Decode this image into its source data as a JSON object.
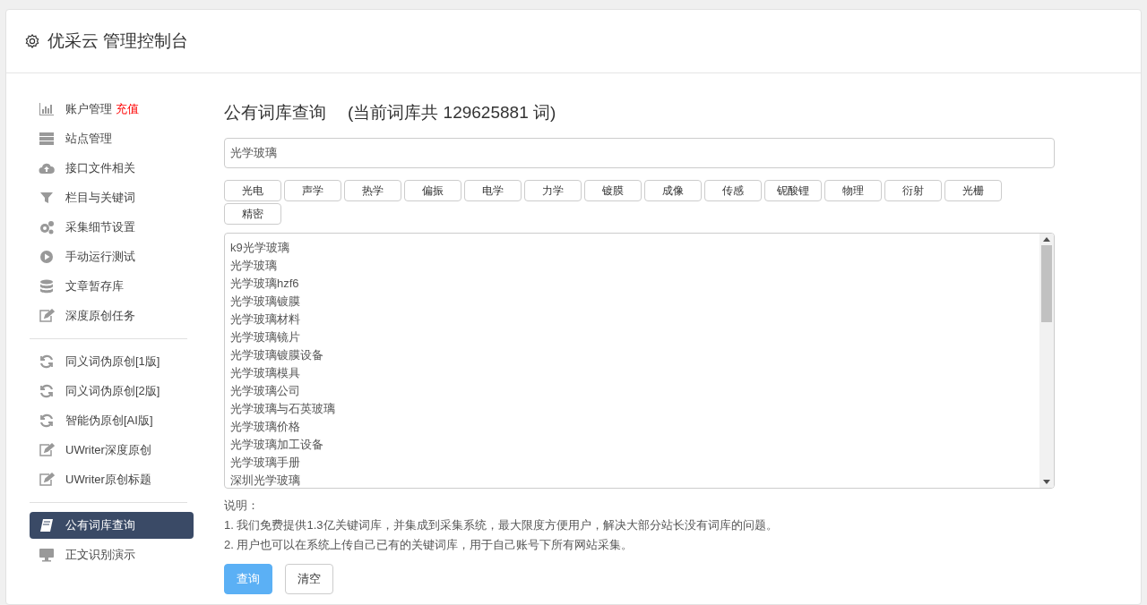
{
  "header": {
    "title": "优采云 管理控制台"
  },
  "sidebar": {
    "groups": [
      {
        "items": [
          {
            "label": "账户管理",
            "badge": "充值",
            "selected": false
          },
          {
            "label": "站点管理",
            "selected": false
          },
          {
            "label": "接口文件相关",
            "selected": false
          },
          {
            "label": "栏目与关键词",
            "selected": false
          },
          {
            "label": "采集细节设置",
            "selected": false
          },
          {
            "label": "手动运行测试",
            "selected": false
          },
          {
            "label": "文章暂存库",
            "selected": false
          },
          {
            "label": "深度原创任务",
            "selected": false
          }
        ]
      },
      {
        "items": [
          {
            "label": "同义词伪原创[1版]",
            "selected": false
          },
          {
            "label": "同义词伪原创[2版]",
            "selected": false
          },
          {
            "label": "智能伪原创[AI版]",
            "selected": false
          },
          {
            "label": "UWriter深度原创",
            "selected": false
          },
          {
            "label": "UWriter原创标题",
            "selected": false
          }
        ]
      },
      {
        "items": [
          {
            "label": "公有词库查询",
            "selected": true
          },
          {
            "label": "正文识别演示",
            "selected": false
          }
        ]
      }
    ]
  },
  "main": {
    "title": "公有词库查询",
    "count_note": "(当前词库共 129625881 词)",
    "search": {
      "value": "光学玻璃"
    },
    "tags": [
      "光电",
      "声学",
      "热学",
      "偏振",
      "电学",
      "力学",
      "镀膜",
      "成像",
      "传感",
      "铌酸锂",
      "物理",
      "衍射",
      "光栅",
      "精密"
    ],
    "results": [
      "k9光学玻璃",
      "光学玻璃",
      "光学玻璃hzf6",
      "光学玻璃镀膜",
      "光学玻璃材料",
      "光学玻璃镜片",
      "光学玻璃镀膜设备",
      "光学玻璃模具",
      "光学玻璃公司",
      "光学玻璃与石英玻璃",
      "光学玻璃价格",
      "光学玻璃加工设备",
      "光学玻璃手册",
      "深圳光学玻璃"
    ],
    "notes": {
      "heading": "说明：",
      "lines": [
        "1. 我们免费提供1.3亿关键词库，并集成到采集系统，最大限度方便用户，解决大部分站长没有词库的问题。",
        "2. 用户也可以在系统上传自己已有的关键词库，用于自己账号下所有网站采集。"
      ]
    },
    "buttons": [
      {
        "label": "查询",
        "kind": "primary"
      },
      {
        "label": "清空",
        "kind": "default"
      }
    ]
  }
}
